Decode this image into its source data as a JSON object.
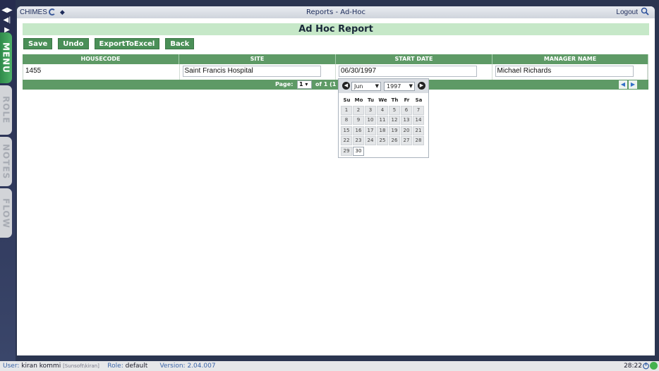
{
  "app": {
    "name": "CHIMES"
  },
  "window": {
    "title": "Reports - Ad-Hoc",
    "logout_label": "Logout"
  },
  "side_tabs": [
    "MENU",
    "ROLE",
    "NOTES",
    "FLOW"
  ],
  "report": {
    "heading": "Ad Hoc Report"
  },
  "toolbar": {
    "save": "Save",
    "undo": "Undo",
    "export": "ExportToExcel",
    "back": "Back"
  },
  "grid": {
    "columns": [
      "HOUSECODE",
      "SITE",
      "START DATE",
      "MANAGER NAME"
    ],
    "rows": [
      {
        "housecode": "1455",
        "site": "Saint Francis Hospital",
        "start_date": "06/30/1997",
        "manager": "Michael Richards"
      }
    ],
    "pager": {
      "label": "Page:",
      "page": "1",
      "of_text": "of 1 (1"
    }
  },
  "calendar": {
    "month": "Jun",
    "year": "1997",
    "dows": [
      "Su",
      "Mo",
      "Tu",
      "We",
      "Th",
      "Fr",
      "Sa"
    ],
    "weeks": [
      [
        "",
        "1",
        "2",
        "3",
        "4",
        "5",
        "6",
        "7"
      ],
      [
        "8",
        "9",
        "10",
        "11",
        "12",
        "13",
        "14"
      ],
      [
        "15",
        "16",
        "17",
        "18",
        "19",
        "20",
        "21"
      ],
      [
        "22",
        "23",
        "24",
        "25",
        "26",
        "27",
        "28"
      ],
      [
        "29",
        "30",
        "",
        "",
        "",
        "",
        ""
      ]
    ],
    "selected_day": "30"
  },
  "status": {
    "user_label": "User:",
    "user": "kiran kommi",
    "user_account": "[Sunsoft\\kiran]",
    "role_label": "Role:",
    "role": "default",
    "version_label": "Version:",
    "version": "2.04.007",
    "time": "28:22"
  },
  "colors": {
    "accent_green": "#4a8f57",
    "header_green": "#5e9a66",
    "report_band": "#c6e8c8"
  }
}
